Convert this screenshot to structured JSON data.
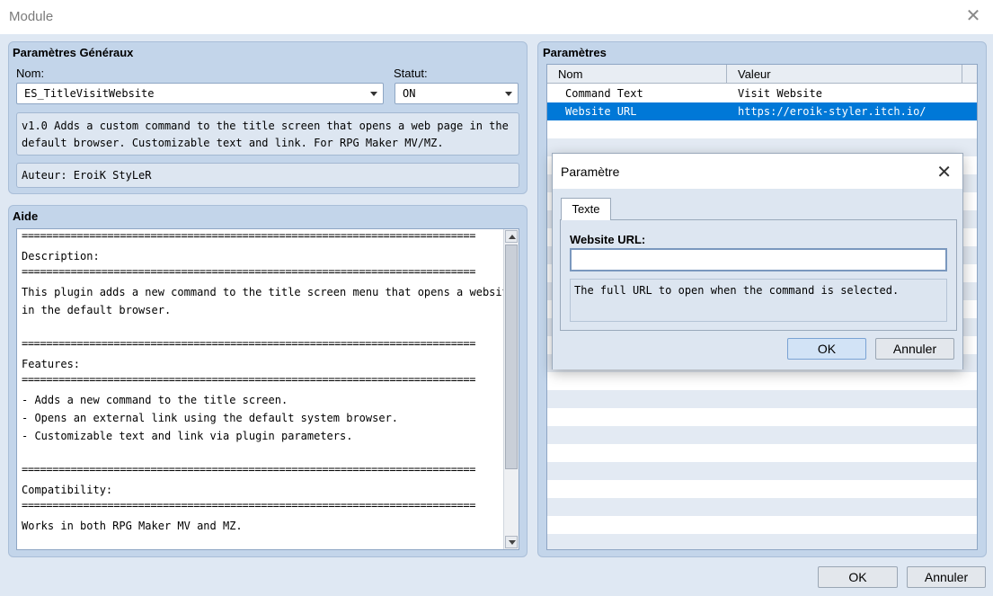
{
  "window": {
    "title": "Module",
    "close": "✕"
  },
  "general": {
    "title": "Paramètres Généraux",
    "name_label": "Nom:",
    "name_value": "ES_TitleVisitWebsite",
    "status_label": "Statut:",
    "status_value": "ON",
    "description_line1": "v1.0 Adds a custom command to the title screen that opens a web page in the",
    "description_line2": "default browser. Customizable text and link. For RPG Maker MV/MZ.",
    "author": "Auteur: EroiK StyLeR"
  },
  "help": {
    "title": "Aide",
    "separator": "==========================================================================",
    "lines": [
      "",
      "Description:",
      "",
      "This plugin adds a new command to the title screen menu that opens a website",
      "in the default browser.",
      "",
      "",
      "Features:",
      "",
      "- Adds a new command to the title screen.",
      "- Opens an external link using the default system browser.",
      "- Customizable text and link via plugin parameters.",
      "",
      "",
      "Compatibility:",
      "",
      "Works in both RPG Maker MV and MZ."
    ]
  },
  "params": {
    "title": "Paramètres",
    "columns": {
      "name": "Nom",
      "value": "Valeur"
    },
    "rows": [
      {
        "name": "Command Text",
        "value": "Visit Website"
      },
      {
        "name": "Website URL",
        "value": "https://eroik-styler.itch.io/"
      }
    ]
  },
  "dialog": {
    "title": "Paramètre",
    "close": "✕",
    "tab": "Texte",
    "field_label": "Website URL:",
    "field_value": "",
    "field_description": "The full URL to open when the command is selected.",
    "ok": "OK",
    "cancel": "Annuler"
  },
  "footer": {
    "ok": "OK",
    "cancel": "Annuler"
  },
  "colors": {
    "selection": "#0078d7",
    "panel": "#c3d5ea",
    "background": "#dfe8f3"
  }
}
